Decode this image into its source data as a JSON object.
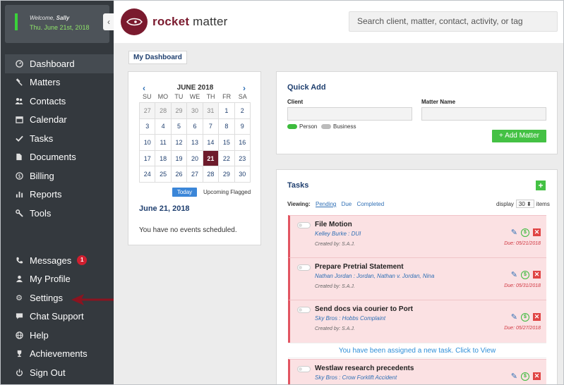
{
  "welcome": {
    "prefix": "Welcome, ",
    "user": "Sally",
    "date": "Thu. June 21st, 2018"
  },
  "sidebar": {
    "items": [
      {
        "label": "Dashboard",
        "icon": "dashboard-icon"
      },
      {
        "label": "Matters",
        "icon": "gavel-icon"
      },
      {
        "label": "Contacts",
        "icon": "contacts-icon"
      },
      {
        "label": "Calendar",
        "icon": "calendar-icon"
      },
      {
        "label": "Tasks",
        "icon": "check-icon"
      },
      {
        "label": "Documents",
        "icon": "document-icon"
      },
      {
        "label": "Billing",
        "icon": "dollar-icon"
      },
      {
        "label": "Reports",
        "icon": "chart-icon"
      },
      {
        "label": "Tools",
        "icon": "wrench-icon"
      }
    ],
    "bottom": [
      {
        "label": "Messages",
        "icon": "phone-icon",
        "badge": "1"
      },
      {
        "label": "My Profile",
        "icon": "user-icon"
      },
      {
        "label": "Settings",
        "icon": "gear-icon"
      },
      {
        "label": "Chat Support",
        "icon": "chat-icon"
      },
      {
        "label": "Help",
        "icon": "globe-icon"
      },
      {
        "label": "Achievements",
        "icon": "trophy-icon"
      },
      {
        "label": "Sign Out",
        "icon": "power-icon"
      }
    ]
  },
  "header": {
    "brand_rocket": "rocket",
    "brand_matter": " matter",
    "search_placeholder": "Search client, matter, contact, activity, or tag"
  },
  "dashboard": {
    "tab_label": "My Dashboard"
  },
  "calendar": {
    "prev": "‹",
    "next": "›",
    "month": "JUNE 2018",
    "weekdays": [
      "SU",
      "MO",
      "TU",
      "WE",
      "TH",
      "FR",
      "SA"
    ],
    "days": [
      "27",
      "28",
      "29",
      "30",
      "31",
      "1",
      "2",
      "3",
      "4",
      "5",
      "6",
      "7",
      "8",
      "9",
      "10",
      "11",
      "12",
      "13",
      "14",
      "15",
      "16",
      "17",
      "18",
      "19",
      "20",
      "21",
      "22",
      "23",
      "24",
      "25",
      "26",
      "27",
      "28",
      "29",
      "30"
    ],
    "today_btn": "Today",
    "flagged_btn": "Upcoming Flagged",
    "selected_date": "June 21, 2018",
    "no_events": "You have no events scheduled."
  },
  "quick_add": {
    "title": "Quick Add",
    "client_label": "Client",
    "matter_label": "Matter Name",
    "person_label": "Person",
    "business_label": "Business",
    "add_button": "+ Add Matter"
  },
  "tasks": {
    "title": "Tasks",
    "plus": "+",
    "viewing_label": "Viewing:",
    "filters": [
      "Pending",
      "Due",
      "Completed"
    ],
    "display_label": "display",
    "display_value": "30 ⬍",
    "items_label": "items",
    "list": [
      {
        "title": "File Motion",
        "matter": "Kelley Burke : DUI",
        "created": "Created by: S.A.J.",
        "due": "Due: 05/21/2018"
      },
      {
        "title": "Prepare Pretrial Statement",
        "matter": "Nathan Jordan : Jordan, Nathan v. Jordan, Nina",
        "created": "Created by: S.A.J.",
        "due": "Due: 05/31/2018"
      },
      {
        "title": "Send docs via courier to Port",
        "matter": "Sky Bros : Hobbs Complaint",
        "created": "Created by: S.A.J.",
        "due": "Due: 05/27/2018"
      },
      {
        "title": "Westlaw research precedents",
        "matter": "Sky Bros : Crow Forklift Accident",
        "created": "",
        "due": ""
      }
    ],
    "assigned_notice": "You have been assigned a new task. Click to View"
  },
  "colors": {
    "sidebar_bg": "#34393e",
    "brand": "#7a1a2e",
    "accent_green": "#44c144",
    "link_blue": "#2f6fb5",
    "task_bg": "#fbe1e3"
  }
}
